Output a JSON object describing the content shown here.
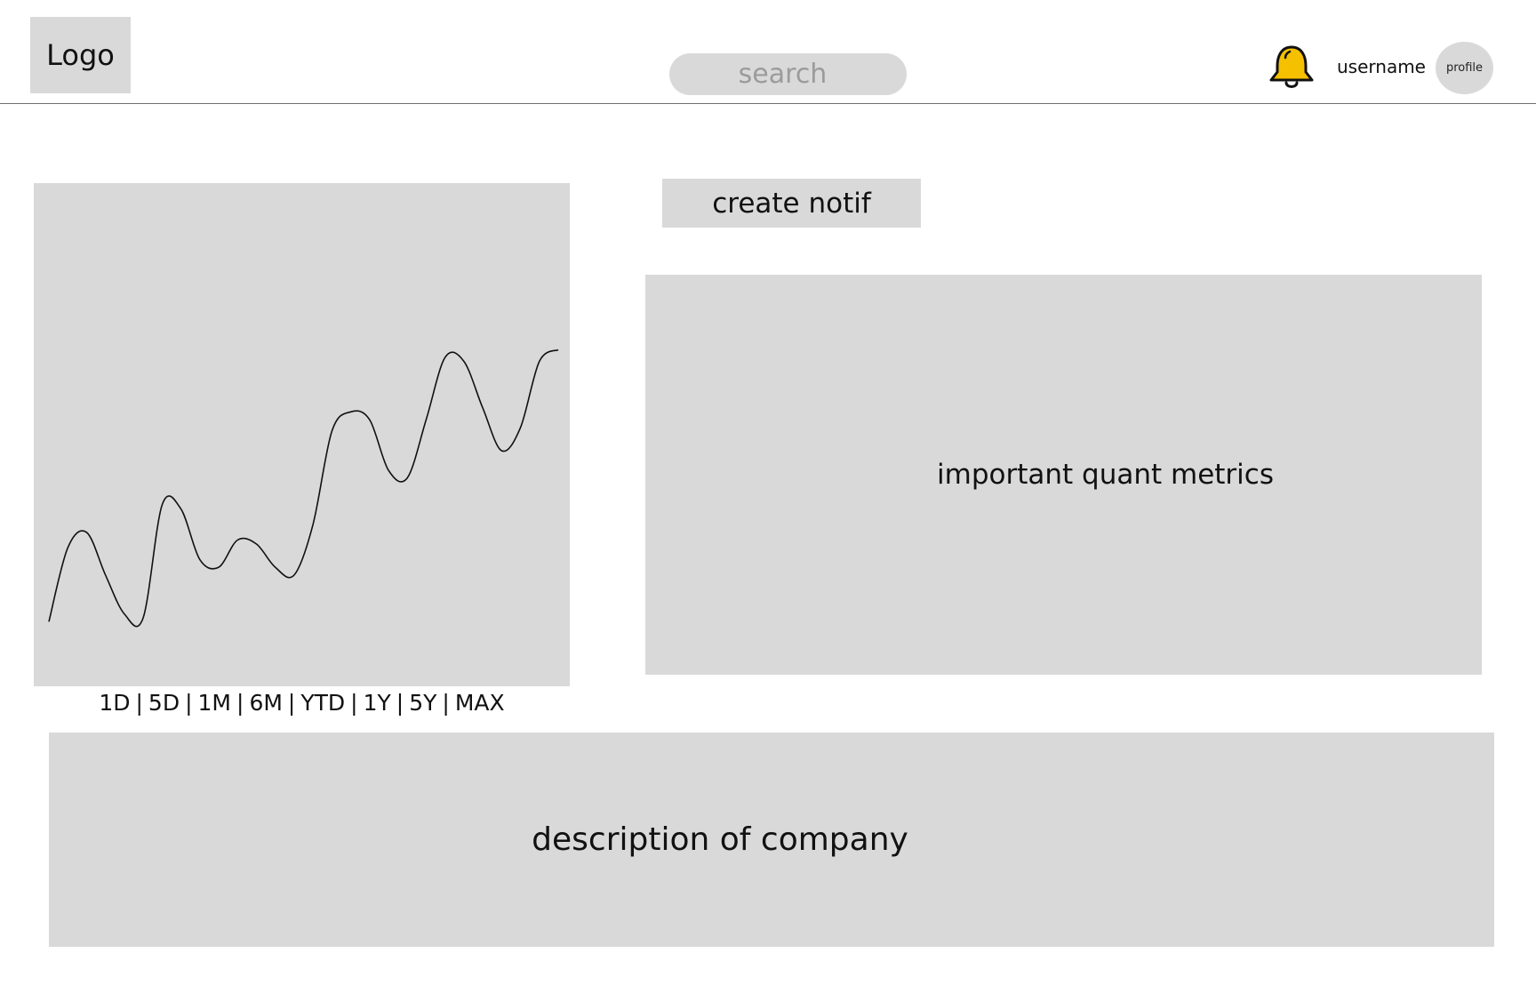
{
  "header": {
    "logo_text": "Logo",
    "search_placeholder": "search",
    "username": "username",
    "profile_label": "profile",
    "bell_color": "#F5C000"
  },
  "chart": {
    "time_ranges": [
      "1D",
      "5D",
      "1M",
      "6M",
      "YTD",
      "1Y",
      "5Y",
      "MAX"
    ],
    "separator": "|"
  },
  "chart_data": {
    "type": "line",
    "title": "",
    "xlabel": "",
    "ylabel": "",
    "grid": false,
    "series": [
      {
        "values": [
          0.1,
          0.29,
          0.33,
          0.22,
          0.12,
          0.11,
          0.4,
          0.39,
          0.26,
          0.24,
          0.31,
          0.3,
          0.24,
          0.22,
          0.35,
          0.59,
          0.64,
          0.62,
          0.49,
          0.47,
          0.62,
          0.78,
          0.77,
          0.65,
          0.54,
          0.6,
          0.77,
          0.8
        ]
      }
    ]
  },
  "main": {
    "create_notif_label": "create notif",
    "metrics_label": "important quant metrics",
    "description_label": "description of company"
  },
  "colors": {
    "panel": "#D9D9D9",
    "divider": "#6E6E6E",
    "bell": "#F5C000"
  }
}
